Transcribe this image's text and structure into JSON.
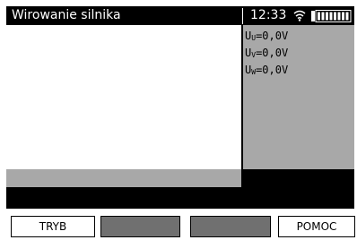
{
  "header": {
    "title": "Wirowanie silnika",
    "time": "12:33"
  },
  "icons": {
    "wifi": "wifi-icon",
    "battery": "battery-icon"
  },
  "readings": [
    {
      "symbol": "U",
      "subscript": "U",
      "value": "=0,0V"
    },
    {
      "symbol": "U",
      "subscript": "V",
      "value": "=0,0V"
    },
    {
      "symbol": "U",
      "subscript": "W",
      "value": "=0,0V"
    }
  ],
  "softkeys": [
    {
      "label": "TRYB",
      "enabled": true
    },
    {
      "label": "",
      "enabled": false
    },
    {
      "label": "",
      "enabled": false
    },
    {
      "label": "POMOC",
      "enabled": true
    }
  ],
  "colors": {
    "header_bg": "#000000",
    "header_text": "#ffffff",
    "panel_gray": "#a8a8a8",
    "disabled_key": "#707070"
  }
}
